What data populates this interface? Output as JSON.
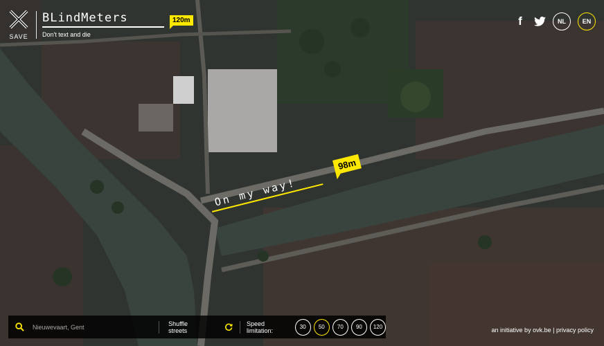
{
  "brand": {
    "logo_text": "SAVE",
    "app_title": "BLindMeters",
    "distance_badge": "120m",
    "tagline": "Don't text and die"
  },
  "social": {
    "facebook_label": "f"
  },
  "languages": [
    {
      "code": "NL",
      "active": false
    },
    {
      "code": "EN",
      "active": true
    }
  ],
  "map": {
    "message_text": "On my way!",
    "distance_badge": "98m"
  },
  "search": {
    "placeholder": "Nieuwevaart, Gent"
  },
  "shuffle": {
    "label": "Shuffle streets"
  },
  "speed": {
    "label": "Speed limitation:",
    "options": [
      "30",
      "50",
      "70",
      "90",
      "120"
    ],
    "selected": "50"
  },
  "footer": {
    "initiative": "an initiative by ovk.be",
    "divider": "|",
    "privacy": "privacy policy"
  },
  "colors": {
    "accent": "#ffe800",
    "canal": "#39443f",
    "bar": "#000000"
  }
}
